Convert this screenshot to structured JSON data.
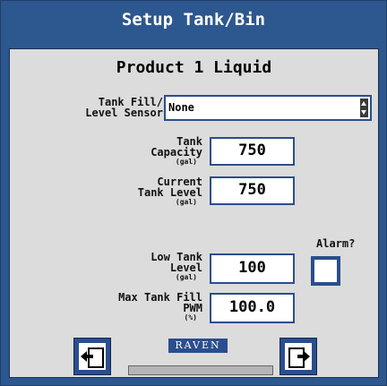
{
  "window": {
    "title": "Setup Tank/Bin"
  },
  "product": {
    "title": "Product 1 Liquid"
  },
  "fields": {
    "sensor": {
      "label_line1": "Tank Fill/",
      "label_line2": "Level Sensor",
      "value": "None"
    },
    "capacity": {
      "label_line1": "Tank",
      "label_line2": "Capacity",
      "unit": "(gal)",
      "value": "750"
    },
    "current_level": {
      "label_line1": "Current",
      "label_line2": "Tank Level",
      "unit": "(gal)",
      "value": "750"
    },
    "low_level": {
      "label_line1": "Low Tank",
      "label_line2": "Level",
      "unit": "(gal)",
      "value": "100"
    },
    "max_fill_pwm": {
      "label_line1": "Max Tank Fill",
      "label_line2": "PWM",
      "unit": "(%)",
      "value": "100.0"
    },
    "alarm": {
      "label": "Alarm?",
      "checked": false
    }
  },
  "footer": {
    "logo_text": "RAVEN",
    "progress": 0
  },
  "icons": {
    "back": "document-arrow-left-icon",
    "next": "document-arrow-right-icon",
    "spinner": "up-down-spinner-icon"
  },
  "colors": {
    "frame": "#2d578f",
    "panel": "#dcdcdc",
    "accent": "#2a4e8e"
  }
}
